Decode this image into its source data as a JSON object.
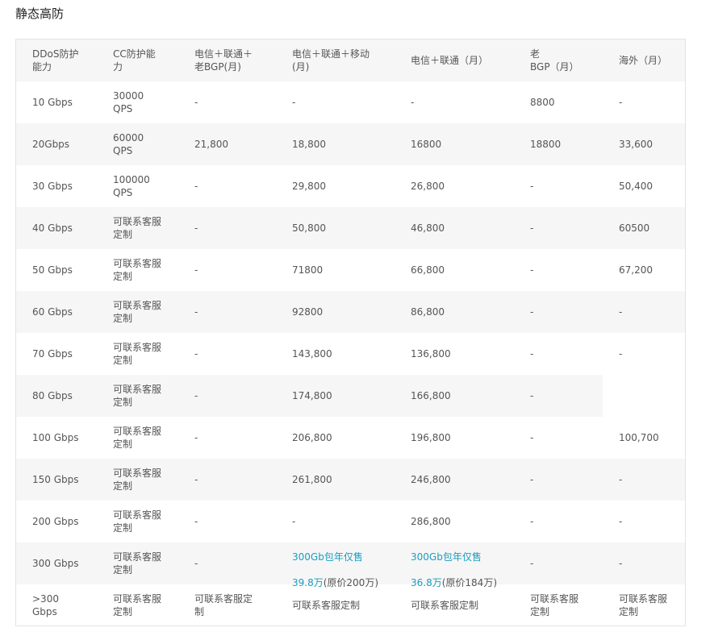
{
  "page": {
    "title": "静态高防"
  },
  "table": {
    "headers": [
      "DDoS防护\n能力",
      "CC防护能\n力",
      "电信＋联通＋\n老BGP(月)",
      "电信＋联通＋移动\n(月)",
      "电信＋联通（月）",
      "老\nBGP（月）",
      "海外（月）"
    ],
    "rows": [
      [
        "10 Gbps",
        "30000\nQPS",
        "-",
        "-",
        "-",
        "8800",
        "-"
      ],
      [
        "20Gbps",
        "60000\nQPS",
        "21,800",
        "18,800",
        "16800",
        "18800",
        "33,600"
      ],
      [
        "30 Gbps",
        "100000\nQPS",
        "-",
        "29,800",
        "26,800",
        "-",
        "50,400"
      ],
      [
        "40 Gbps",
        "可联系客服\n定制",
        "-",
        "50,800",
        "46,800",
        "-",
        "60500"
      ],
      [
        "50 Gbps",
        "可联系客服\n定制",
        "-",
        "71800",
        "66,800",
        "-",
        "67,200"
      ],
      [
        "60 Gbps",
        "可联系客服\n定制",
        "-",
        "92800",
        "86,800",
        "-",
        "-"
      ],
      [
        "70 Gbps",
        "可联系客服\n定制",
        "-",
        "143,800",
        "136,800",
        "-",
        "-"
      ],
      [
        "80 Gbps",
        "可联系客服\n定制",
        "-",
        "174,800",
        "166,800",
        "-",
        ""
      ],
      [
        "100 Gbps",
        "可联系客服\n定制",
        "-",
        "206,800",
        "196,800",
        "-",
        "100,700"
      ],
      [
        "150 Gbps",
        "可联系客服\n定制",
        "-",
        "261,800",
        "246,800",
        "-",
        "-"
      ],
      [
        "200 Gbps",
        "可联系客服\n定制",
        "-",
        "-",
        "286,800",
        "-",
        "-"
      ],
      [
        "300 Gbps",
        "可联系客服\n定制",
        "-",
        "",
        "",
        "-",
        "-"
      ],
      [
        ">300\nGbps",
        "可联系客服\n定制",
        "可联系客服定\n制",
        "可联系客服定制",
        "可联系客服定制",
        "可联系客服\n定制",
        "可联系客服\n定制"
      ]
    ],
    "promo_300": {
      "col3": {
        "line1": "300Gb包年仅售",
        "price": "39.8万",
        "orig": "(原价200万)"
      },
      "col4": {
        "line1": "300Gb包年仅售",
        "price": "36.8万",
        "orig": "(原价184万)"
      }
    }
  },
  "colors": {
    "accent": "#1a9dbf",
    "stripe": "#f6f6f6",
    "border": "#e3e3e3"
  }
}
